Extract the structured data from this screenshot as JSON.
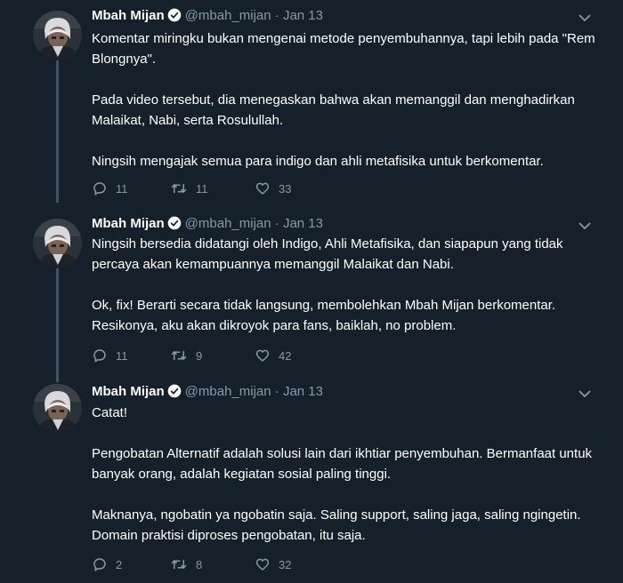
{
  "colors": {
    "background": "#15202b",
    "text": "#ffffff",
    "muted": "#8899a6",
    "thread_line": "#3d5466",
    "verified": "#ffffff"
  },
  "tweets": [
    {
      "author_name": "Mbah Mijan",
      "handle": "@mbah_mijan",
      "dot": "·",
      "date": "Jan 13",
      "paragraphs": [
        "Komentar miringku bukan mengenai  metode penyembuhannya, tapi lebih pada \"Rem Blongnya\".",
        "Pada video tersebut, dia menegaskan bahwa akan memanggil dan menghadirkan Malaikat, Nabi, serta Rosulullah.",
        "Ningsih mengajak semua para indigo dan ahli metafisika untuk berkomentar."
      ],
      "replies": "11",
      "retweets": "11",
      "likes": "33"
    },
    {
      "author_name": "Mbah Mijan",
      "handle": "@mbah_mijan",
      "dot": "·",
      "date": "Jan 13",
      "paragraphs": [
        "Ningsih bersedia didatangi oleh Indigo, Ahli Metafisika, dan siapapun yang tidak percaya akan kemampuannya memanggil Malaikat dan Nabi.",
        "Ok, fix! Berarti secara tidak langsung, membolehkan Mbah Mijan berkomentar. Resikonya, aku akan dikroyok para fans, baiklah, no problem."
      ],
      "replies": "11",
      "retweets": "9",
      "likes": "42"
    },
    {
      "author_name": "Mbah Mijan",
      "handle": "@mbah_mijan",
      "dot": "·",
      "date": "Jan 13",
      "paragraphs": [
        "Catat!",
        "Pengobatan Alternatif adalah solusi lain dari ikhtiar penyembuhan. Bermanfaat untuk banyak orang, adalah kegiatan sosial paling tinggi.",
        "Maknanya, ngobatin ya ngobatin saja. Saling support, saling jaga, saling ngingetin. Domain praktisi diproses pengobatan, itu saja."
      ],
      "replies": "2",
      "retweets": "8",
      "likes": "32"
    }
  ]
}
